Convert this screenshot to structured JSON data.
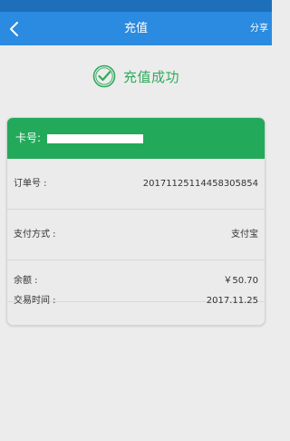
{
  "nav": {
    "title": "充值",
    "share_label": "分享",
    "back_icon": "back-arrow-icon"
  },
  "result": {
    "icon": "check-circle-icon",
    "text": "充值成功",
    "color": "#2fab5c"
  },
  "card": {
    "label": "卡号:",
    "header_color": "#23a95a",
    "rows": [
      {
        "label": "订单号 :",
        "value": "20171125114458305854"
      },
      {
        "label": "支付方式 :",
        "value": "支付宝"
      },
      {
        "label": "余额 :",
        "value": "￥50.70"
      },
      {
        "label": "交易时间 :",
        "value": "2017.11.25"
      }
    ]
  },
  "colors": {
    "nav_bar": "#2a8be0",
    "status_bar": "#1d6fb9",
    "background": "#ececec"
  }
}
